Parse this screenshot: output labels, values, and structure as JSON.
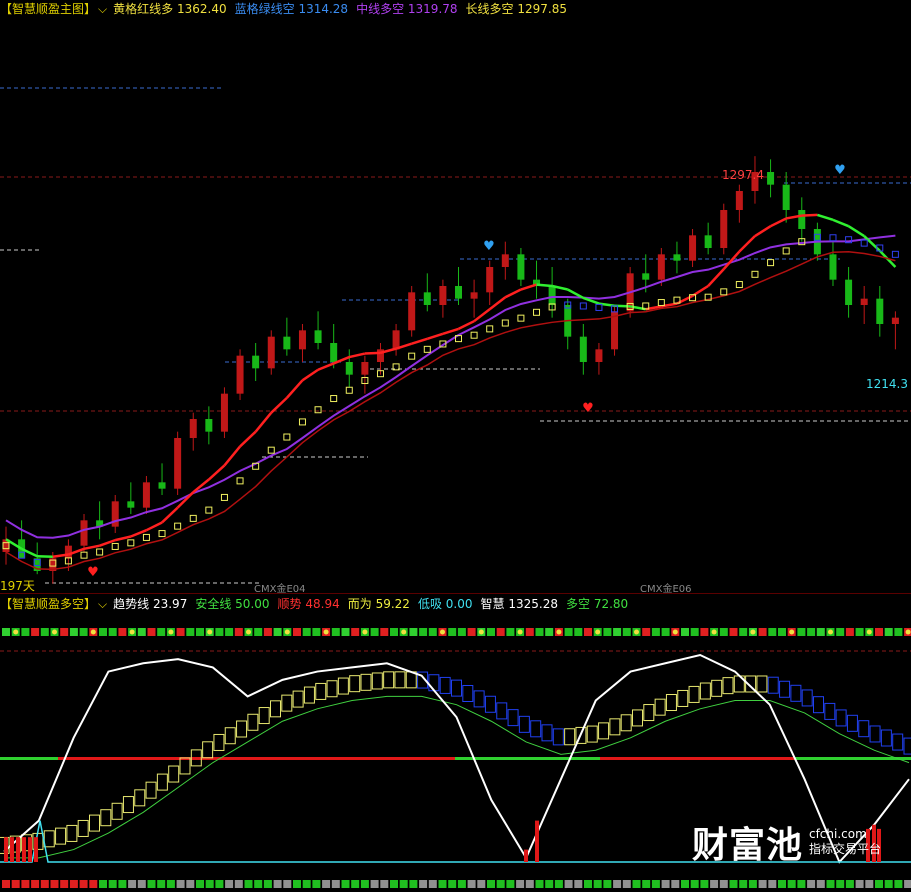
{
  "main_legend": {
    "title": "【智慧顺盈主图】",
    "items": [
      {
        "label": "黄格红线多",
        "value": "1362.40",
        "color": "#f0e040"
      },
      {
        "label": "蓝格绿线空",
        "value": "1314.28",
        "color": "#3a8cf0"
      },
      {
        "label": "中线多空",
        "value": "1319.78",
        "color": "#b040f0"
      },
      {
        "label": "长线多空",
        "value": "1297.85",
        "color": "#f0e040"
      }
    ]
  },
  "sub_legend": {
    "title": "【智慧顺盈多空】",
    "items": [
      {
        "label": "趋势线",
        "value": "23.97",
        "color": "#ffffff"
      },
      {
        "label": "安全线",
        "value": "50.00",
        "color": "#40e040"
      },
      {
        "label": "顺势",
        "value": "48.94",
        "color": "#ff3030"
      },
      {
        "label": "而为",
        "value": "59.22",
        "color": "#f0f040"
      },
      {
        "label": "低吸",
        "value": "0.00",
        "color": "#40e0f0"
      },
      {
        "label": "智慧",
        "value": "1325.28",
        "color": "#ffffff"
      },
      {
        "label": "多空",
        "value": "72.80",
        "color": "#40e040"
      }
    ]
  },
  "labels": {
    "high": "1297.4",
    "low": "1214.3",
    "days": "197天",
    "contract1": "CMX金E04",
    "contract2": "CMX金E06"
  },
  "logo": {
    "big": "财富池",
    "url": "cfchi.com",
    "sub": "指标交易平台"
  },
  "chart_data": [
    {
      "type": "candlestick",
      "title": "智慧顺盈主图",
      "ohlc_approx": [
        [
          1172,
          1180,
          1168,
          1176
        ],
        [
          1176,
          1182,
          1172,
          1170
        ],
        [
          1170,
          1175,
          1165,
          1166
        ],
        [
          1166,
          1172,
          1162,
          1170
        ],
        [
          1170,
          1176,
          1166,
          1174
        ],
        [
          1174,
          1184,
          1172,
          1182
        ],
        [
          1182,
          1188,
          1176,
          1180
        ],
        [
          1180,
          1190,
          1178,
          1188
        ],
        [
          1188,
          1194,
          1184,
          1186
        ],
        [
          1186,
          1196,
          1184,
          1194
        ],
        [
          1194,
          1200,
          1190,
          1192
        ],
        [
          1192,
          1210,
          1190,
          1208
        ],
        [
          1208,
          1216,
          1204,
          1214
        ],
        [
          1214,
          1218,
          1206,
          1210
        ],
        [
          1210,
          1224,
          1208,
          1222
        ],
        [
          1222,
          1236,
          1220,
          1234
        ],
        [
          1234,
          1238,
          1226,
          1230
        ],
        [
          1230,
          1242,
          1228,
          1240
        ],
        [
          1240,
          1246,
          1234,
          1236
        ],
        [
          1236,
          1244,
          1232,
          1242
        ],
        [
          1242,
          1248,
          1236,
          1238
        ],
        [
          1238,
          1244,
          1230,
          1232
        ],
        [
          1232,
          1236,
          1224,
          1228
        ],
        [
          1228,
          1234,
          1222,
          1232
        ],
        [
          1232,
          1238,
          1228,
          1236
        ],
        [
          1236,
          1244,
          1234,
          1242
        ],
        [
          1242,
          1256,
          1240,
          1254
        ],
        [
          1254,
          1260,
          1248,
          1250
        ],
        [
          1250,
          1258,
          1246,
          1256
        ],
        [
          1256,
          1262,
          1250,
          1252
        ],
        [
          1252,
          1258,
          1246,
          1254
        ],
        [
          1254,
          1264,
          1250,
          1262
        ],
        [
          1262,
          1270,
          1258,
          1266
        ],
        [
          1266,
          1268,
          1256,
          1258
        ],
        [
          1258,
          1264,
          1252,
          1256
        ],
        [
          1256,
          1262,
          1246,
          1250
        ],
        [
          1250,
          1252,
          1236,
          1240
        ],
        [
          1240,
          1244,
          1228,
          1232
        ],
        [
          1232,
          1238,
          1228,
          1236
        ],
        [
          1236,
          1250,
          1234,
          1248
        ],
        [
          1248,
          1262,
          1246,
          1260
        ],
        [
          1260,
          1266,
          1254,
          1258
        ],
        [
          1258,
          1268,
          1256,
          1266
        ],
        [
          1266,
          1270,
          1260,
          1264
        ],
        [
          1264,
          1274,
          1262,
          1272
        ],
        [
          1272,
          1276,
          1266,
          1268
        ],
        [
          1268,
          1282,
          1266,
          1280
        ],
        [
          1280,
          1288,
          1276,
          1286
        ],
        [
          1286,
          1297,
          1282,
          1292
        ],
        [
          1292,
          1296,
          1284,
          1288
        ],
        [
          1288,
          1292,
          1276,
          1280
        ],
        [
          1280,
          1284,
          1270,
          1274
        ],
        [
          1274,
          1276,
          1264,
          1266
        ],
        [
          1266,
          1270,
          1256,
          1258
        ],
        [
          1258,
          1262,
          1246,
          1250
        ],
        [
          1250,
          1256,
          1244,
          1252
        ],
        [
          1252,
          1256,
          1240,
          1244
        ],
        [
          1244,
          1248,
          1236,
          1246
        ]
      ],
      "overlay_values": {
        "黄格红线多": 1362.4,
        "蓝格绿线空": 1314.28,
        "中线多空": 1319.78,
        "长线多空": 1297.85
      },
      "annotations": [
        "1297.4",
        "1214.3",
        "197天"
      ]
    },
    {
      "type": "line",
      "title": "智慧顺盈多空",
      "series": [
        {
          "name": "趋势线",
          "values": [
            5,
            20,
            60,
            92,
            96,
            98,
            94,
            80,
            88,
            92,
            94,
            96,
            90,
            70,
            30,
            2,
            40,
            78,
            92,
            96,
            100,
            92,
            76,
            40,
            0,
            18,
            40
          ]
        },
        {
          "name": "安全线",
          "values": [
            50,
            50,
            50,
            50,
            50,
            50,
            50,
            50,
            50,
            50,
            50,
            50,
            50,
            50,
            50,
            50,
            50,
            50,
            50,
            50,
            50,
            50,
            50,
            50,
            50,
            50,
            50
          ]
        },
        {
          "name": "而为",
          "values": [
            8,
            10,
            14,
            22,
            32,
            44,
            56,
            66,
            76,
            82,
            86,
            88,
            88,
            84,
            76,
            66,
            60,
            62,
            68,
            76,
            82,
            86,
            86,
            80,
            70,
            62,
            56
          ]
        }
      ],
      "ylim": [
        0,
        100
      ],
      "last_values": {
        "趋势线": 23.97,
        "安全线": 50.0,
        "顺势": 48.94,
        "而为": 59.22,
        "低吸": 0.0,
        "智慧": 1325.28,
        "多空": 72.8
      }
    }
  ]
}
